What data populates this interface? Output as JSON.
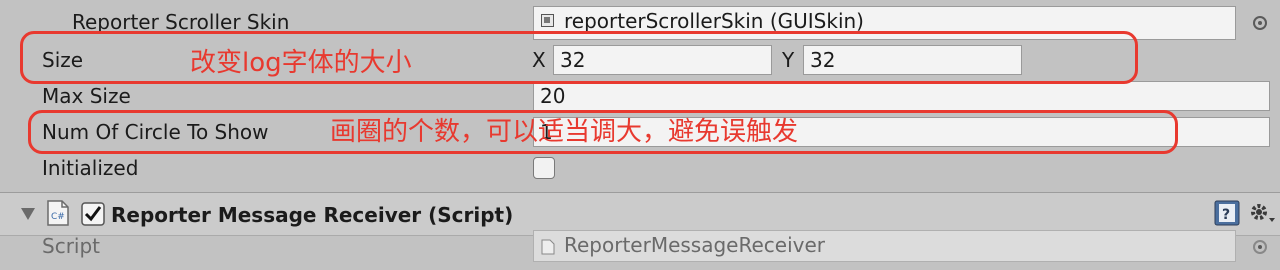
{
  "rows": {
    "skin": {
      "label": "Reporter Scroller Skin",
      "value": "reporterScrollerSkin (GUISkin)"
    },
    "size": {
      "label": "Size",
      "x_label": "X",
      "x_value": "32",
      "y_label": "Y",
      "y_value": "32"
    },
    "max_size": {
      "label": "Max Size",
      "value": "20"
    },
    "num_circle": {
      "label": "Num Of Circle To Show",
      "value": "1"
    },
    "initialized": {
      "label": "Initialized",
      "checked": false
    }
  },
  "annotations": {
    "size_note": "改变log字体的大小",
    "circle_note": "画圈的个数，可以适当调大，避免误触发"
  },
  "component": {
    "title": "Reporter Message Receiver (Script)",
    "enabled": true,
    "script_label": "Script",
    "script_value": "ReporterMessageReceiver"
  },
  "colors": {
    "annotation_red": "#e8392f",
    "inspector_bg": "#c2c2c2"
  }
}
